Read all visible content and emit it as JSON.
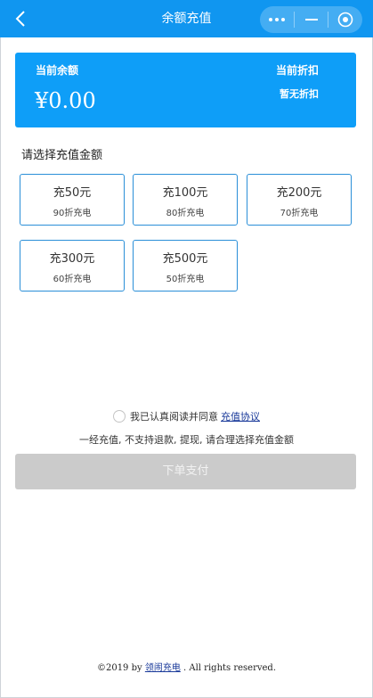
{
  "header": {
    "title": "余额充值"
  },
  "balance": {
    "label": "当前余额",
    "amount": "¥0.00",
    "discount_label": "当前折扣",
    "discount_value": "暂无折扣"
  },
  "section_title": "请选择充值金额",
  "options": [
    {
      "amount": "充50元",
      "discount": "90折充电"
    },
    {
      "amount": "充100元",
      "discount": "80折充电"
    },
    {
      "amount": "充200元",
      "discount": "70折充电"
    },
    {
      "amount": "充300元",
      "discount": "60折充电"
    },
    {
      "amount": "充500元",
      "discount": "50折充电"
    }
  ],
  "agreement": {
    "text": "我已认真阅读并同意",
    "link": "充值协议",
    "checked": false
  },
  "notice": "一经充值, 不支持退款, 提现, 请合理选择充值金额",
  "pay_button": "下单支付",
  "footer": {
    "prefix": "©2019 by",
    "link": "领闹充电",
    "suffix": ". All rights reserved."
  },
  "colors": {
    "header": "#1096f0",
    "card": "#0e9ef8",
    "option_border": "#2a8fd8",
    "pay_disabled": "#cbcbcb"
  },
  "icons": [
    "back-arrow-icon",
    "more-icon",
    "minimize-icon",
    "close-target-icon"
  ]
}
